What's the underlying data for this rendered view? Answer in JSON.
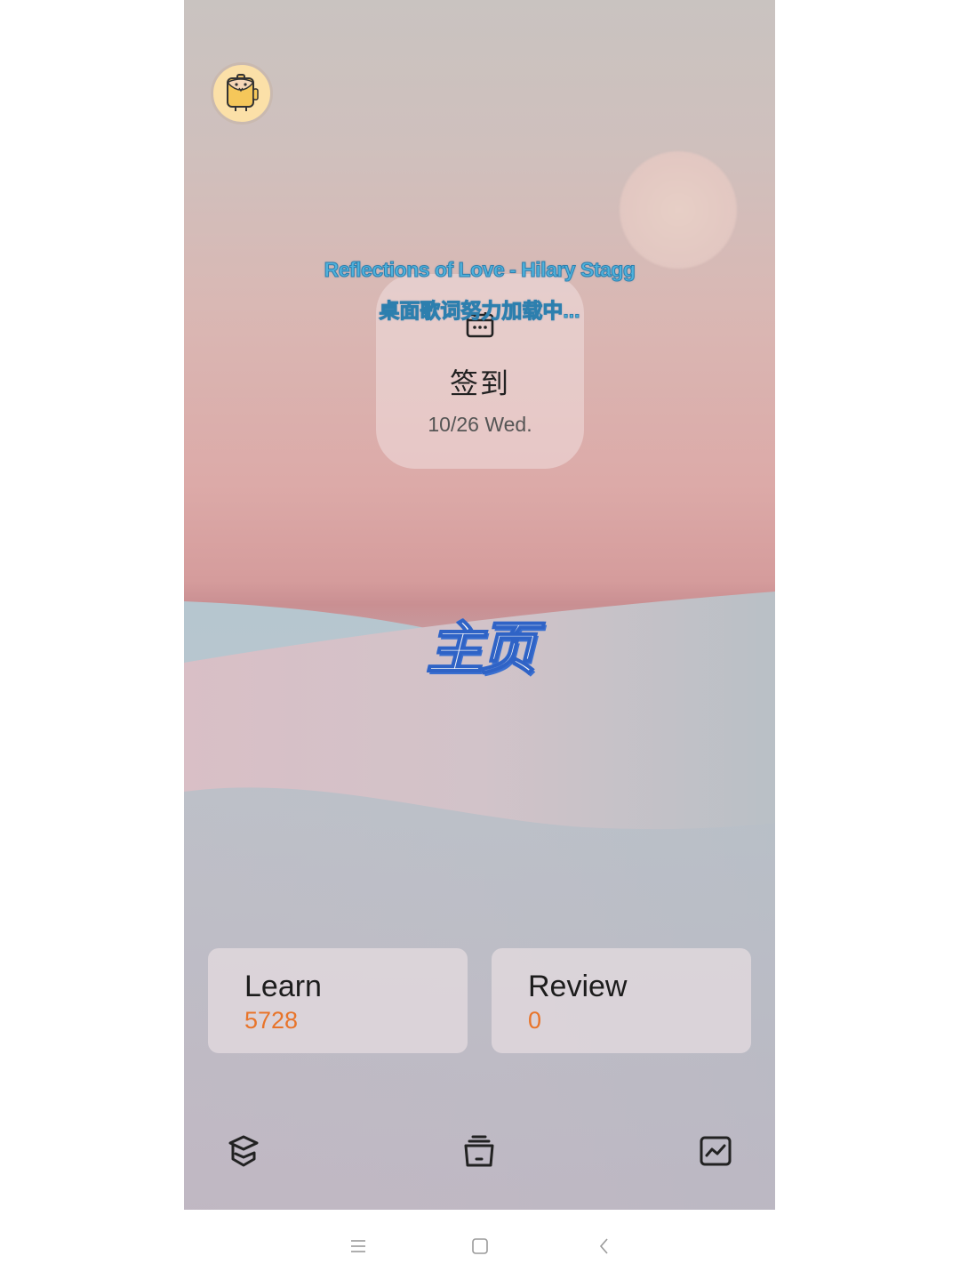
{
  "app": {
    "avatar": {
      "icon": "backpack-mascot-icon",
      "bg_color": "#fbe0a8"
    },
    "lyrics": {
      "song_line": "Reflections of Love - Hilary Stagg",
      "status_line": "桌面歌词努力加载中...",
      "color": "#4fb2dc"
    },
    "checkin": {
      "icon": "calendar-icon",
      "title": "签到",
      "date": "10/26 Wed."
    },
    "page_title": "主页",
    "stats": [
      {
        "label": "Learn",
        "value": "5728"
      },
      {
        "label": "Review",
        "value": "0"
      }
    ],
    "accent_color": "#e8742a",
    "tabbar": [
      {
        "name": "learn",
        "icon": "graduation-cap-icon"
      },
      {
        "name": "library",
        "icon": "archive-box-icon"
      },
      {
        "name": "statistics",
        "icon": "line-chart-icon"
      }
    ]
  },
  "system_nav": [
    {
      "name": "menu",
      "icon": "menu-icon"
    },
    {
      "name": "home",
      "icon": "home-square-icon"
    },
    {
      "name": "back",
      "icon": "back-chevron-icon"
    }
  ]
}
